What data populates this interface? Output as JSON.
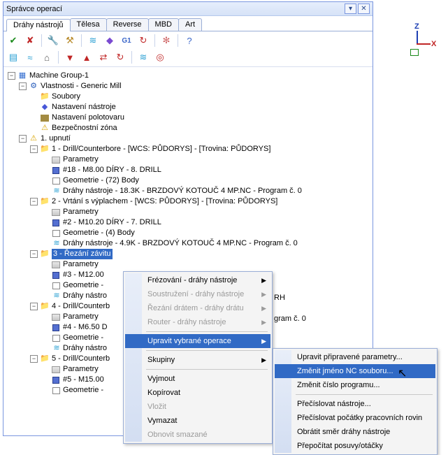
{
  "window": {
    "title": "Správce operací"
  },
  "tabs": [
    "Dráhy nástrojů",
    "Tělesa",
    "Reverse",
    "MBD",
    "Art"
  ],
  "tree": {
    "root": "Machine Group-1",
    "props": "Vlastnosti - Generic Mill",
    "props_children": {
      "files": "Soubory",
      "tool": "Nastavení nástroje",
      "stock": "Nastavení polotovaru",
      "safety": "Bezpečnostní zóna"
    },
    "setup": "1. upnutí",
    "ops": [
      {
        "title": "1 - Drill/Counterbore - [WCS: PŮDORYS] - [Trovina: PŮDORYS]",
        "param": "Parametry",
        "tool": "#18 - M8.00 DÍRY -   8. DRILL",
        "geom": "Geometrie - (72) Body",
        "path": "Dráhy nástroje - 18.3K - BRZDOVÝ KOTOUČ 4 MP.NC - Program č. 0"
      },
      {
        "title": "2 - Vrtání s výplachem - [WCS: PŮDORYS] - [Trovina: PŮDORYS]",
        "param": "Parametry",
        "tool": "#2 - M10.20 DÍRY -   7. DRILL",
        "geom": "Geometrie - (4) Body",
        "path": "Dráhy nástroje - 4.9K - BRZDOVÝ KOTOUČ 4 MP.NC - Program č. 0"
      },
      {
        "title_short": "3 - Řezání závitu",
        "param": "Parametry",
        "tool": "#3 - M12.00",
        "tool_tail": "RH",
        "geom": "Geometrie -",
        "path": "Dráhy nástro",
        "path_tail": "gram č. 0"
      },
      {
        "title_short": "4 - Drill/Counterb",
        "param": "Parametry",
        "tool": "#4 - M6.50 D",
        "geom": "Geometrie -",
        "path": "Dráhy nástro"
      },
      {
        "title_short": "5 - Drill/Counterb",
        "param": "Parametry",
        "tool": "#5 - M15.00",
        "geom": "Geometrie -"
      }
    ]
  },
  "menu1": {
    "milling": "Frézování - dráhy nástroje",
    "turning": "Soustružení - dráhy nástroje",
    "wire": "Řezání drátem - dráhy drátu",
    "router": "Router - dráhy nástroje",
    "edit_sel": "Upravit vybrané operace",
    "groups": "Skupiny",
    "cut": "Vyjmout",
    "copy": "Kopírovat",
    "paste": "Vložit",
    "delete": "Vymazat",
    "undo_del": "Obnovit smazané"
  },
  "menu2": {
    "edit_params": "Upravit připravené parametry...",
    "rename_nc": "Změnit jméno NC souboru...",
    "change_prog": "Změnit číslo programu...",
    "renum_tools": "Přečíslovat nástroje...",
    "renum_wcs": "Přečíslovat počátky pracovních rovin",
    "reverse": "Obrátit směr dráhy nástroje",
    "recalc": "Přepočítat posuvy/otáčky"
  },
  "axis": {
    "z": "Z",
    "x": "X"
  }
}
